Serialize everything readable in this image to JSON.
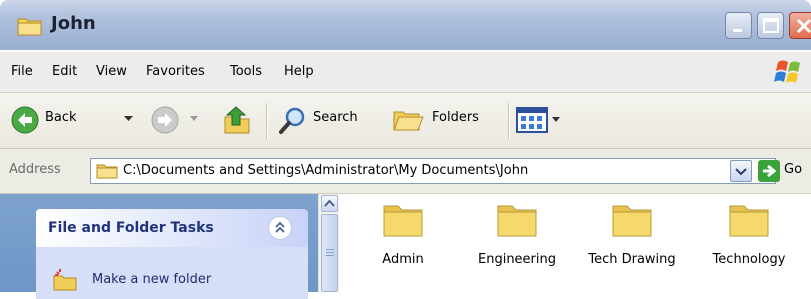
{
  "window": {
    "title": "John"
  },
  "menu": {
    "items": [
      "File",
      "Edit",
      "View",
      "Favorites",
      "Tools",
      "Help"
    ]
  },
  "toolbar": {
    "back_label": "Back",
    "search_label": "Search",
    "folders_label": "Folders"
  },
  "address": {
    "label": "Address",
    "value": "C:\\Documents and Settings\\Administrator\\My Documents\\John",
    "go_label": "Go"
  },
  "tasks": {
    "title": "File and Folder Tasks",
    "items": [
      "Make a new folder"
    ]
  },
  "files": [
    {
      "name": "Admin",
      "icon": "folder-icon"
    },
    {
      "name": "Engineering",
      "icon": "folder-icon"
    },
    {
      "name": "Tech Drawing",
      "icon": "folder-icon"
    },
    {
      "name": "Technology",
      "icon": "folder-icon"
    }
  ],
  "colors": {
    "title_bar": "#a3b6d6",
    "task_pane": "#7da2ce",
    "task_header_text": "#21347b",
    "folder_yellow": "#f6d96b",
    "go_green": "#3aa33a",
    "close_red": "#e06d52"
  }
}
